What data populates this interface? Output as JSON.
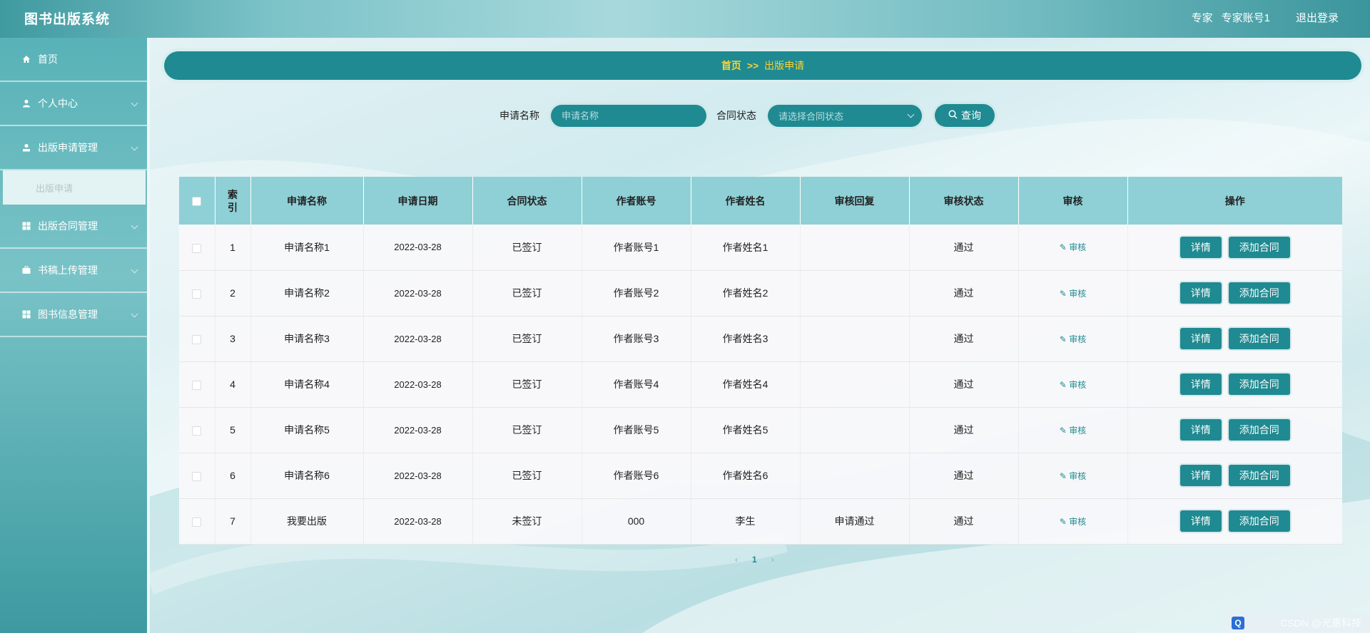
{
  "app": {
    "title": "图书出版系统"
  },
  "header": {
    "role": "专家",
    "account": "专家账号1",
    "logout": "退出登录"
  },
  "sidebar": {
    "items": [
      {
        "label": "首页",
        "icon": "home-icon"
      },
      {
        "label": "个人中心",
        "icon": "user-icon"
      },
      {
        "label": "出版申请管理",
        "icon": "user-manage-icon"
      },
      {
        "label": "出版合同管理",
        "icon": "grid-icon"
      },
      {
        "label": "书稿上传管理",
        "icon": "briefcase-icon"
      },
      {
        "label": "图书信息管理",
        "icon": "grid-icon"
      }
    ],
    "submenu": {
      "label": "出版申请"
    }
  },
  "breadcrumb": {
    "home": "首页",
    "sep": ">>",
    "current": "出版申请"
  },
  "search": {
    "name_label": "申请名称",
    "name_placeholder": "申请名称",
    "status_label": "合同状态",
    "status_placeholder": "请选择合同状态",
    "query_label": "查询"
  },
  "table": {
    "columns": [
      "索引",
      "申请名称",
      "申请日期",
      "合同状态",
      "作者账号",
      "作者姓名",
      "审核回复",
      "审核状态",
      "审核",
      "操作"
    ],
    "audit_link": "审核",
    "detail_btn": "详情",
    "add_contract_btn": "添加合同",
    "rows": [
      {
        "index": "1",
        "name": "申请名称1",
        "date": "2022-03-28",
        "contract": "已签订",
        "account": "作者账号1",
        "author": "作者姓名1",
        "reply": "",
        "status": "通过"
      },
      {
        "index": "2",
        "name": "申请名称2",
        "date": "2022-03-28",
        "contract": "已签订",
        "account": "作者账号2",
        "author": "作者姓名2",
        "reply": "",
        "status": "通过"
      },
      {
        "index": "3",
        "name": "申请名称3",
        "date": "2022-03-28",
        "contract": "已签订",
        "account": "作者账号3",
        "author": "作者姓名3",
        "reply": "",
        "status": "通过"
      },
      {
        "index": "4",
        "name": "申请名称4",
        "date": "2022-03-28",
        "contract": "已签订",
        "account": "作者账号4",
        "author": "作者姓名4",
        "reply": "",
        "status": "通过"
      },
      {
        "index": "5",
        "name": "申请名称5",
        "date": "2022-03-28",
        "contract": "已签订",
        "account": "作者账号5",
        "author": "作者姓名5",
        "reply": "",
        "status": "通过"
      },
      {
        "index": "6",
        "name": "申请名称6",
        "date": "2022-03-28",
        "contract": "已签订",
        "account": "作者账号6",
        "author": "作者姓名6",
        "reply": "",
        "status": "通过"
      },
      {
        "index": "7",
        "name": "我要出版",
        "date": "2022-03-28",
        "contract": "未签订",
        "account": "000",
        "author": "李生",
        "reply": "申请通过",
        "status": "通过"
      }
    ]
  },
  "pager": {
    "prev": "‹",
    "current": "1",
    "next": "›"
  },
  "watermark": "CSDN @光惠科技"
}
